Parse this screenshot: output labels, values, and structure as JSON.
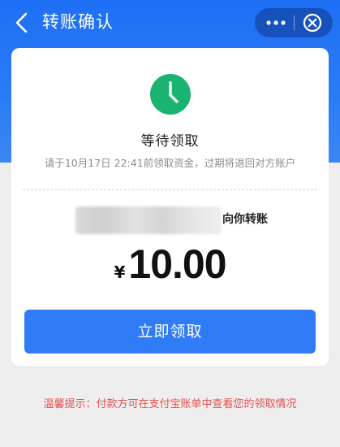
{
  "nav": {
    "title": "转账确认",
    "back_icon": "chevron-left-icon",
    "more_icon": "more-dots-icon",
    "close_icon": "close-circle-icon"
  },
  "status": {
    "icon": "clock-icon",
    "title": "等待领取",
    "description": "请于10月17日 22:41前领取资金，过期将退回对方账户"
  },
  "transfer": {
    "sender_suffix": "向你转账",
    "currency_symbol": "¥",
    "amount": "10.00"
  },
  "actions": {
    "receive_label": "立即领取"
  },
  "footer": {
    "tip": "温馨提示：付款方可在支付宝账单中查看您的领取情况"
  },
  "colors": {
    "header_blue": "#1e6ff5",
    "button_blue": "#2f7cf6",
    "status_green": "#1ab371",
    "tip_red": "#e5504f"
  }
}
